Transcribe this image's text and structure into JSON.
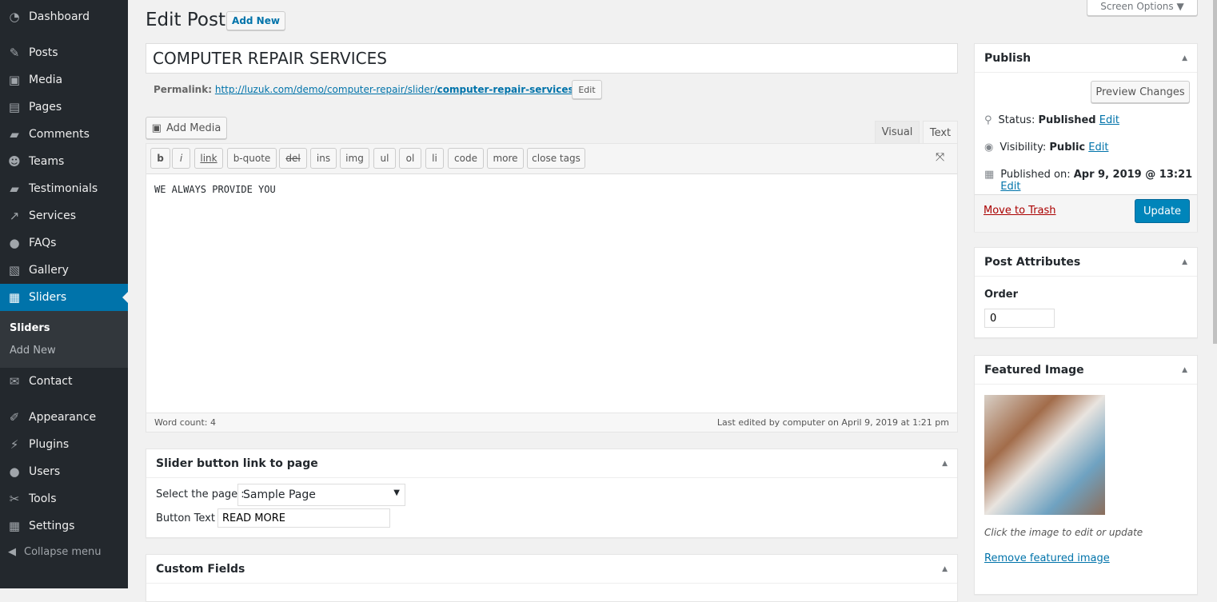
{
  "sidebar": {
    "items": [
      {
        "label": "Dashboard",
        "icon": "dashboard-icon",
        "glyph": "◔"
      },
      {
        "label": "Posts",
        "icon": "pin-icon",
        "glyph": "✎"
      },
      {
        "label": "Media",
        "icon": "media-icon",
        "glyph": "▣"
      },
      {
        "label": "Pages",
        "icon": "pages-icon",
        "glyph": "▤"
      },
      {
        "label": "Comments",
        "icon": "comment-icon",
        "glyph": "▰"
      },
      {
        "label": "Teams",
        "icon": "groups-icon",
        "glyph": "☻"
      },
      {
        "label": "Testimonials",
        "icon": "testimonial-icon",
        "glyph": "▰"
      },
      {
        "label": "Services",
        "icon": "share-icon",
        "glyph": "↗"
      },
      {
        "label": "FAQs",
        "icon": "faq-icon",
        "glyph": "●"
      },
      {
        "label": "Gallery",
        "icon": "gallery-icon",
        "glyph": "▧"
      },
      {
        "label": "Sliders",
        "icon": "slides-icon",
        "glyph": "▦"
      },
      {
        "label": "Contact",
        "icon": "email-icon",
        "glyph": "✉"
      },
      {
        "label": "Appearance",
        "icon": "brush-icon",
        "glyph": "✐"
      },
      {
        "label": "Plugins",
        "icon": "plugin-icon",
        "glyph": "⚡"
      },
      {
        "label": "Users",
        "icon": "user-icon",
        "glyph": "●"
      },
      {
        "label": "Tools",
        "icon": "wrench-icon",
        "glyph": "✂"
      },
      {
        "label": "Settings",
        "icon": "settings-icon",
        "glyph": "▦"
      }
    ],
    "submenu": [
      "Sliders",
      "Add New"
    ],
    "collapse": "Collapse menu"
  },
  "header": {
    "title": "Edit Post",
    "add_new": "Add New",
    "screen_options": "Screen Options ▼"
  },
  "post": {
    "title": "COMPUTER REPAIR SERVICES",
    "permalink_label": "Permalink:",
    "permalink_base": "http://luzuk.com/demo/computer-repair/slider/",
    "permalink_slug": "computer-repair-services-2/",
    "edit": "Edit"
  },
  "editor": {
    "add_media": "Add Media",
    "tabs": [
      "Visual",
      "Text"
    ],
    "quicktags": [
      "b",
      "i",
      "link",
      "b-quote",
      "del",
      "ins",
      "img",
      "ul",
      "ol",
      "li",
      "code",
      "more",
      "close tags"
    ],
    "content": "WE ALWAYS PROVIDE YOU",
    "word_count": "Word count: 4",
    "last_edited": "Last edited by computer on April 9, 2019 at 1:21 pm"
  },
  "slider_box": {
    "title": "Slider button link to page",
    "select_label": "Select the page :",
    "select_value": "Sample Page",
    "button_label": "Button Text :",
    "button_value": "READ MORE"
  },
  "custom_fields": {
    "title": "Custom Fields"
  },
  "publish": {
    "title": "Publish",
    "preview": "Preview Changes",
    "status_label": "Status:",
    "status": "Published",
    "visibility_label": "Visibility:",
    "visibility": "Public",
    "published_label": "Published on:",
    "published": "Apr 9, 2019 @ 13:21",
    "edit": "Edit",
    "trash": "Move to Trash",
    "update": "Update"
  },
  "attributes": {
    "title": "Post Attributes",
    "order_label": "Order",
    "order_value": "0"
  },
  "featured": {
    "title": "Featured Image",
    "caption": "Click the image to edit or update",
    "remove": "Remove featured image"
  },
  "colors": {
    "sidebar": "#23282d",
    "accent": "#0073aa",
    "trash": "#a00"
  }
}
